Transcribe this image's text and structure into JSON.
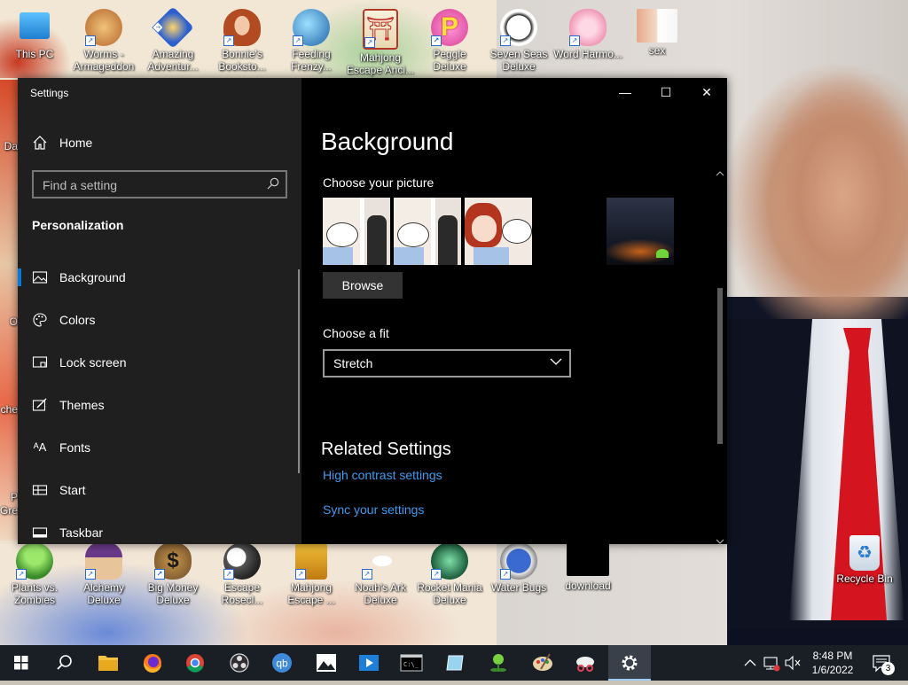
{
  "desktop": {
    "top_icons": [
      {
        "label": "This PC",
        "color": "#1f8fe0"
      },
      {
        "label": "Worms - Armageddon",
        "color": "#c98c3a"
      },
      {
        "label": "Amazing Adventur...",
        "color": "#2b5fd0"
      },
      {
        "label": "Bonnie's Booksto...",
        "color": "#d69a6a"
      },
      {
        "label": "Feeding Frenzy...",
        "color": "#2d88c8"
      },
      {
        "label": "Mahjong Escape Anci...",
        "color": "#c0342c"
      },
      {
        "label": "Peggle Deluxe",
        "color": "#d83b8c"
      },
      {
        "label": "Seven Seas Deluxe",
        "color": "#f1f1f1"
      },
      {
        "label": "Word Harmo...",
        "color": "#e88fb0"
      },
      {
        "label": "sex",
        "color": "#d8c6b0"
      }
    ],
    "bottom_icons": [
      {
        "label": "Plants vs. Zombies",
        "color": "#5aa83a"
      },
      {
        "label": "Alchemy Deluxe",
        "color": "#8a5a2a"
      },
      {
        "label": "Big Money Deluxe",
        "color": "#6a4a2a"
      },
      {
        "label": "Escape Rosecl...",
        "color": "#555"
      },
      {
        "label": "Mahjong Escape ...",
        "color": "#d89a1a"
      },
      {
        "label": "Noah's Ark Deluxe",
        "color": "#ddd"
      },
      {
        "label": "Rocket Mania Deluxe",
        "color": "#2a8a5a"
      },
      {
        "label": "Water Bugs",
        "color": "#3a6ad0"
      },
      {
        "label": "download",
        "color": "#000000"
      },
      {
        "label": "Recycle Bin",
        "color": "#dfe7ef"
      }
    ],
    "left_edge_fragments": [
      "Da",
      "O",
      "che",
      "P",
      "Gre"
    ]
  },
  "window": {
    "title": "Settings",
    "controls": {
      "minimize": "—",
      "maximize": "☐",
      "close": "✕"
    }
  },
  "nav": {
    "home_label": "Home",
    "search_placeholder": "Find a setting",
    "section": "Personalization",
    "items": [
      {
        "label": "Background",
        "icon": "image-icon",
        "active": true
      },
      {
        "label": "Colors",
        "icon": "palette-icon",
        "active": false
      },
      {
        "label": "Lock screen",
        "icon": "lock-screen-icon",
        "active": false
      },
      {
        "label": "Themes",
        "icon": "themes-icon",
        "active": false
      },
      {
        "label": "Fonts",
        "icon": "fonts-icon",
        "active": false
      },
      {
        "label": "Start",
        "icon": "start-icon",
        "active": false
      },
      {
        "label": "Taskbar",
        "icon": "taskbar-icon",
        "active": false
      }
    ]
  },
  "content": {
    "title": "Background",
    "choose_picture_label": "Choose your picture",
    "browse_label": "Browse",
    "choose_fit_label": "Choose a fit",
    "fit_value": "Stretch",
    "related_title": "Related Settings",
    "links": [
      "High contrast settings",
      "Sync your settings"
    ]
  },
  "taskbar": {
    "time": "8:48 PM",
    "date": "1/6/2022",
    "notification_count": "3",
    "accent": "#0a78d7"
  }
}
